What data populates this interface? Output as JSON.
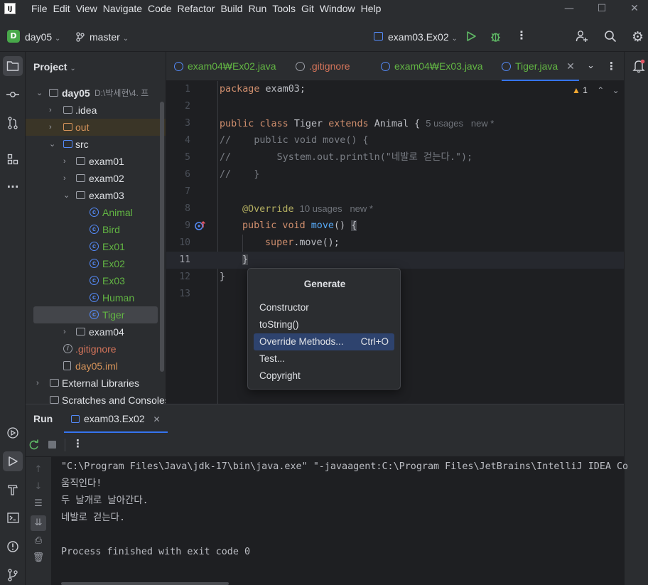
{
  "menu": [
    "File",
    "Edit",
    "View",
    "Navigate",
    "Code",
    "Refactor",
    "Build",
    "Run",
    "Tools",
    "Git",
    "Window",
    "Help"
  ],
  "logo": "IJ",
  "window": {
    "minimize": "—",
    "maximize": "☐",
    "close": "✕"
  },
  "toolbar": {
    "project_badge": "D",
    "project": "day05",
    "branch": "master",
    "run_config": "exam03.Ex02"
  },
  "project_panel": {
    "title": "Project",
    "root": {
      "name": "day05",
      "path": "D:\\박세현\\4. 프"
    },
    "items": {
      "idea": ".idea",
      "out": "out",
      "src": "src",
      "exam01": "exam01",
      "exam02": "exam02",
      "exam03": "exam03",
      "animal": "Animal",
      "bird": "Bird",
      "ex01": "Ex01",
      "ex02": "Ex02",
      "ex03": "Ex03",
      "human": "Human",
      "tiger": "Tiger",
      "exam04": "exam04",
      "gitignore": ".gitignore",
      "iml": "day05.iml",
      "ext_libs": "External Libraries",
      "scratches": "Scratches and Consoles"
    }
  },
  "tabs": [
    {
      "label": "exam04₩Ex02.java"
    },
    {
      "label": ".gitignore"
    },
    {
      "label": "exam04₩Ex03.java"
    },
    {
      "label": "Tiger.java"
    }
  ],
  "editor": {
    "warning_count": "1",
    "line_numbers": [
      "1",
      "2",
      "3",
      "4",
      "5",
      "6",
      "7",
      "8",
      "9",
      "10",
      "11",
      "12",
      "13"
    ],
    "package_kw": "package",
    "package_name": " exam03;",
    "l3_public": "public ",
    "l3_class": "class ",
    "l3_name": "Tiger ",
    "l3_extends": "extends ",
    "l3_rest": "Animal {",
    "l3_hint": "5 usages   new *",
    "l4": "//    public void move() {",
    "l5": "//        System.out.println(\"네발로 걷는다.\");",
    "l6": "//    }",
    "l8_annot": "@Override",
    "l8_hint": "10 usages   new *",
    "l9_kw": "public void ",
    "l9_fn": "move",
    "l9_rest": "() ",
    "l9_brace": "{",
    "l10_kw": "super",
    "l10_rest": ".move();",
    "l11": "}",
    "l12": "}"
  },
  "popup": {
    "title": "Generate",
    "items": [
      {
        "label": "Constructor",
        "shortcut": ""
      },
      {
        "label": "toString()",
        "shortcut": ""
      },
      {
        "label": "Override Methods...",
        "shortcut": "Ctrl+O"
      },
      {
        "label": "Test...",
        "shortcut": ""
      },
      {
        "label": "Copyright",
        "shortcut": ""
      }
    ]
  },
  "run_panel": {
    "title": "Run",
    "tab": "exam03.Ex02",
    "console": [
      "\"C:\\Program Files\\Java\\jdk-17\\bin\\java.exe\" \"-javaagent:C:\\Program Files\\JetBrains\\IntelliJ IDEA Co",
      "움직인다!",
      "두 날개로 날아간다.",
      "네발로 걷는다.",
      "",
      "Process finished with exit code 0"
    ]
  },
  "colors": {
    "accent": "#3574f0",
    "keyword": "#cf8e6d",
    "annotation": "#b3ae60",
    "function": "#56a8f5",
    "class_icon": "#548af7",
    "excluded": "#d5935a",
    "ignored": "#d4745a",
    "vcs_added": "#62b543"
  }
}
